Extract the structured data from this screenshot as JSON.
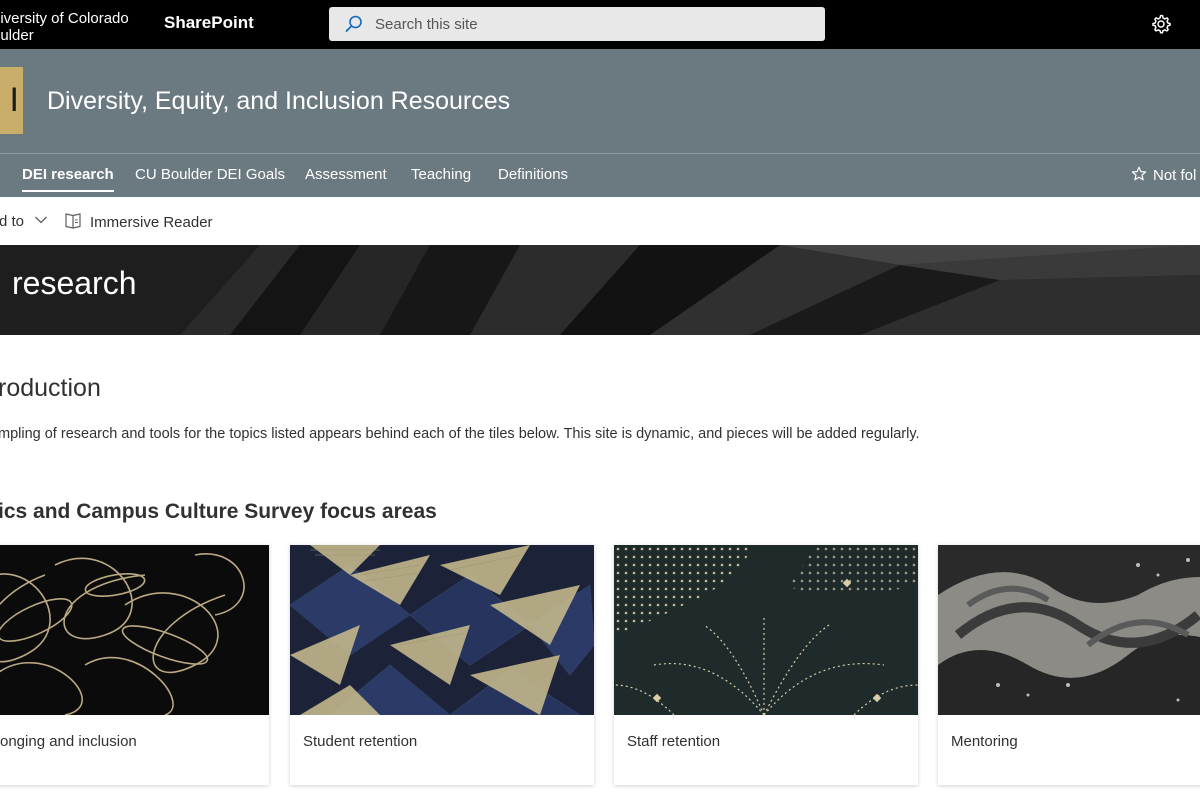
{
  "suitebar": {
    "org_line1": "niversity of Colorado",
    "org_line2": "oulder",
    "app_name": "SharePoint",
    "search_placeholder": "Search this site",
    "settings_icon": "gear-icon"
  },
  "site": {
    "logo_text": "I",
    "logo_color": "#c9ad6a",
    "header_color": "#6b7a80",
    "title": "Diversity, Equity, and Inclusion Resources"
  },
  "nav": {
    "items": [
      {
        "label": "DEI research",
        "active": true
      },
      {
        "label": "CU Boulder DEI Goals",
        "active": false
      },
      {
        "label": "Assessment",
        "active": false
      },
      {
        "label": "Teaching",
        "active": false
      },
      {
        "label": "Definitions",
        "active": false
      }
    ],
    "follow_label": "Not fol"
  },
  "commandbar": {
    "send_to_label": "d to",
    "immersive_reader_label": "Immersive Reader"
  },
  "banner": {
    "title": "research"
  },
  "content": {
    "intro_heading": "roduction",
    "intro_text": "mpling of research and tools for the topics listed appears behind each of the tiles below. This site is dynamic, and pieces will be added regularly.",
    "section_heading": "ics and Campus Culture Survey focus areas",
    "tiles": [
      {
        "label": "onging and inclusion"
      },
      {
        "label": "Student retention"
      },
      {
        "label": "Staff retention"
      },
      {
        "label": "Mentoring"
      }
    ]
  }
}
